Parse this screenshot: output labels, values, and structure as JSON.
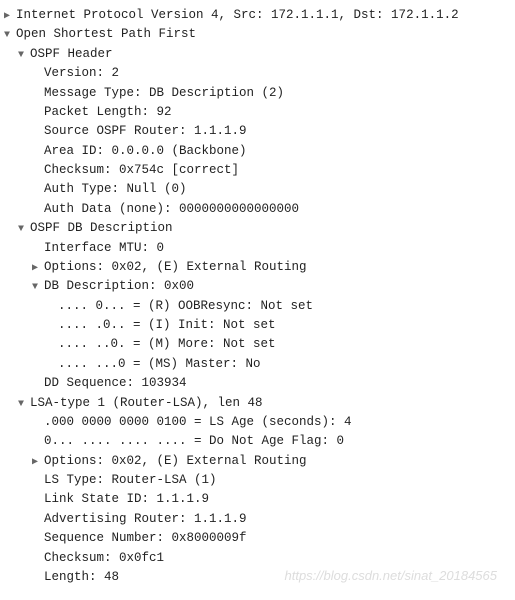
{
  "line0": "Internet Protocol Version 4, Src: 172.1.1.1, Dst: 172.1.1.2",
  "line1": "Open Shortest Path First",
  "line2": "OSPF Header",
  "line3": "Version: 2",
  "line4": "Message Type: DB Description (2)",
  "line5": "Packet Length: 92",
  "line6": "Source OSPF Router: 1.1.1.9",
  "line7": "Area ID: 0.0.0.0 (Backbone)",
  "line8": "Checksum: 0x754c [correct]",
  "line9": "Auth Type: Null (0)",
  "line10": "Auth Data (none): 0000000000000000",
  "line11": "OSPF DB Description",
  "line12": "Interface MTU: 0",
  "line13": "Options: 0x02, (E) External Routing",
  "line14": "DB Description: 0x00",
  "line15": ".... 0... = (R) OOBResync: Not set",
  "line16": ".... .0.. = (I) Init: Not set",
  "line17": ".... ..0. = (M) More: Not set",
  "line18": ".... ...0 = (MS) Master: No",
  "line19": "DD Sequence: 103934",
  "line20": "LSA-type 1 (Router-LSA), len 48",
  "line21": ".000 0000 0000 0100 = LS Age (seconds): 4",
  "line22": "0... .... .... .... = Do Not Age Flag: 0",
  "line23": "Options: 0x02, (E) External Routing",
  "line24": "LS Type: Router-LSA (1)",
  "line25": "Link State ID: 1.1.1.9",
  "line26": "Advertising Router: 1.1.1.9",
  "line27": "Sequence Number: 0x8000009f",
  "line28": "Checksum: 0x0fc1",
  "line29": "Length: 48",
  "watermark": "https://blog.csdn.net/sinat_20184565"
}
